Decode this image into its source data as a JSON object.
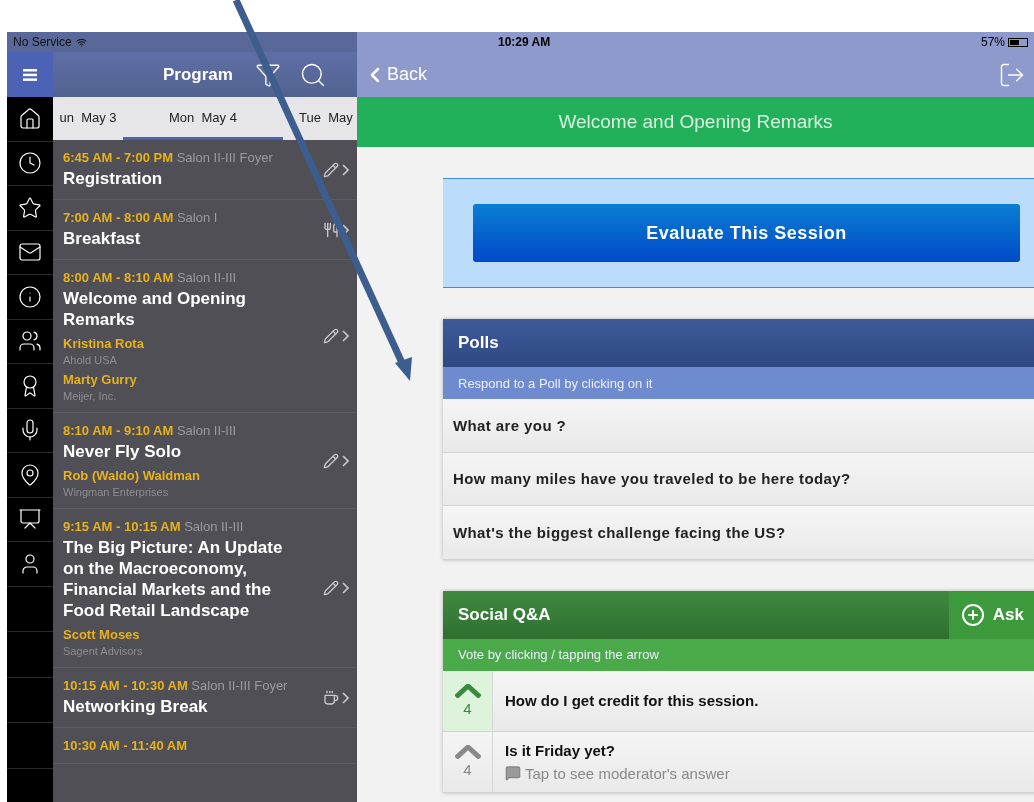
{
  "status_bar": {
    "carrier": "No Service",
    "time": "10:29 AM",
    "battery": "57%"
  },
  "program": {
    "title": "Program",
    "tabs": [
      {
        "label": "un  May 3",
        "selected": false
      },
      {
        "label": "Mon  May 4",
        "selected": true
      },
      {
        "label": "Tue  May",
        "selected": false
      }
    ],
    "sessions": [
      {
        "kind": "session",
        "time": "6:45 AM - 7:00 PM",
        "location": "Salon II-III Foyer",
        "title": "Registration"
      },
      {
        "kind": "meal",
        "time": "7:00 AM - 8:00 AM",
        "location": "Salon I",
        "title": "Breakfast"
      },
      {
        "kind": "session",
        "time": "8:00 AM - 8:10 AM",
        "location": "Salon II-III",
        "title": "Welcome and Opening Remarks",
        "speakers": [
          {
            "name": "Kristina Rota",
            "org": "Ahold USA"
          },
          {
            "name": "Marty Gurry",
            "org": "Meijer, Inc."
          }
        ]
      },
      {
        "kind": "session",
        "time": "8:10 AM - 9:10 AM",
        "location": "Salon II-III",
        "title": "Never Fly Solo",
        "speakers": [
          {
            "name": "Rob (Waldo) Waldman",
            "org": "Wingman Enterprises"
          }
        ]
      },
      {
        "kind": "session",
        "time": "9:15 AM - 10:15 AM",
        "location": "Salon II-III",
        "title": "The Big Picture: An Update on the Macroeconomy, Financial Markets and the Food Retail Landscape",
        "speakers": [
          {
            "name": "Scott Moses",
            "org": "Sagent Advisors"
          }
        ]
      },
      {
        "kind": "break",
        "time": "10:15 AM - 10:30 AM",
        "location": "Salon II-III Foyer",
        "title": "Networking Break"
      },
      {
        "kind": "cut",
        "time": "10:30 AM - 11:40 AM"
      }
    ]
  },
  "detail": {
    "back": "Back",
    "title": "Welcome and Opening Remarks",
    "evaluate_button": "Evaluate This Session",
    "polls": {
      "title": "Polls",
      "hint": "Respond to a Poll by clicking on it",
      "questions": [
        "What are you ?",
        "How many miles have you traveled to be here today?",
        "What's the biggest challenge facing the US?"
      ]
    },
    "qa": {
      "title": "Social Q&A",
      "ask_button": "Ask",
      "hint": "Vote by clicking / tapping the arrow",
      "questions": [
        {
          "text": "How do I get credit for this session.",
          "votes": "4",
          "voted": true
        },
        {
          "text": "Is it Friday yet?",
          "votes": "4",
          "voted": false,
          "answer": "Tap to see moderator's answer"
        }
      ]
    }
  }
}
